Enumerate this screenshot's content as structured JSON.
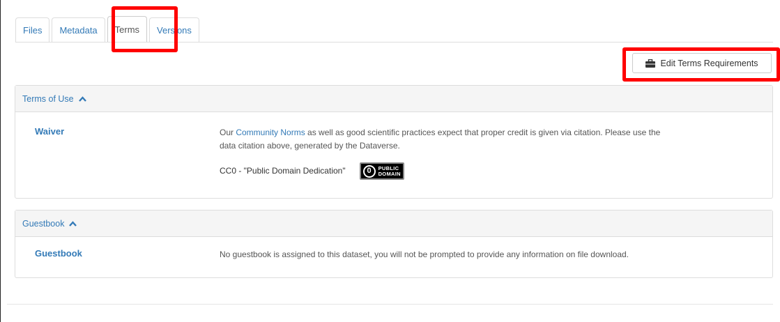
{
  "tabs": [
    {
      "label": "Files"
    },
    {
      "label": "Metadata"
    },
    {
      "label": "Terms"
    },
    {
      "label": "Versions"
    }
  ],
  "toolbar": {
    "edit_terms_label": "Edit Terms Requirements"
  },
  "terms_panel": {
    "title": "Terms of Use",
    "waiver_label": "Waiver",
    "text_prefix": "Our ",
    "community_norms_link": "Community Norms",
    "text_suffix": " as well as good scientific practices expect that proper credit is given via citation. Please use the",
    "text_line2": "data citation above, generated by the Dataverse.",
    "license_text": "CC0 - \"Public Domain Dedication\"",
    "badge_zero": "0",
    "badge_line1": "PUBLIC",
    "badge_line2": "DOMAIN"
  },
  "guestbook_panel": {
    "title": "Guestbook",
    "label": "Guestbook",
    "text": "No guestbook is assigned to this dataset, you will not be prompted to provide any information on file download."
  },
  "colors": {
    "link": "#337ab7",
    "highlight": "#ff0000"
  }
}
